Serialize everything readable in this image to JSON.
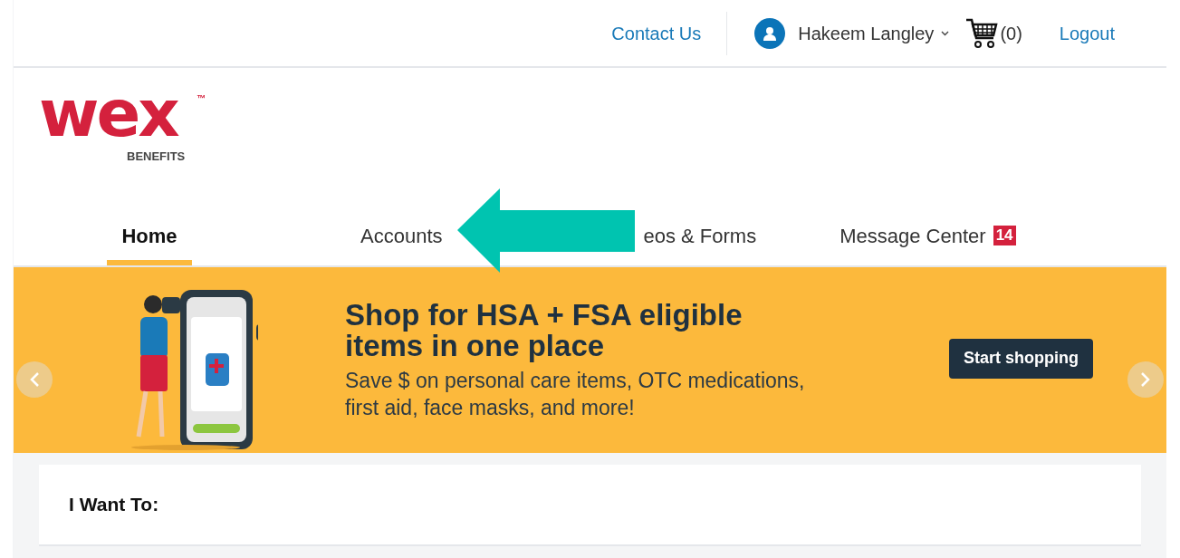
{
  "top_bar": {
    "contact_link": "Contact Us",
    "user_name": "Hakeem Langley",
    "cart_count": "(0)",
    "logout_link": "Logout"
  },
  "logo": {
    "wordmark": "wex",
    "trademark": "™",
    "subtitle": "BENEFITS"
  },
  "tabs": [
    {
      "label": "Home",
      "selected": true
    },
    {
      "label": "Accounts",
      "selected": false
    },
    {
      "label": "eos & Forms",
      "selected": false
    },
    {
      "label": "Message Center",
      "selected": false,
      "badge": "14"
    }
  ],
  "banner": {
    "headline_lines": [
      "Shop for HSA + FSA eligible",
      "items in one place"
    ],
    "text_lines": [
      "Save $ on personal care items, OTC medications,",
      "first aid, face masks, and more!"
    ],
    "button": "Start shopping"
  },
  "card": {
    "title": "I Want To:"
  }
}
